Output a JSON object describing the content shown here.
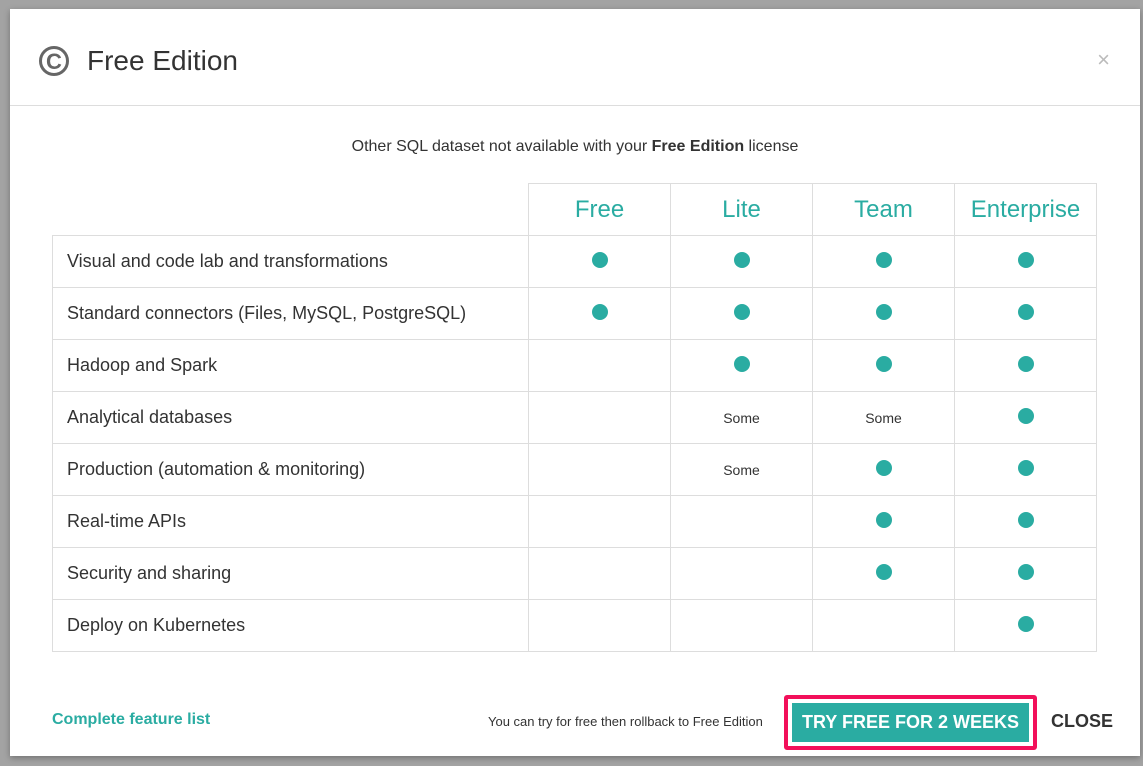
{
  "header": {
    "title": "Free Edition",
    "logo_icon": "copyright-icon",
    "close_icon": "×"
  },
  "subtitle": {
    "prefix": "Other SQL dataset not available with your ",
    "bold": "Free Edition",
    "suffix": " license"
  },
  "table": {
    "columns": [
      "Free",
      "Lite",
      "Team",
      "Enterprise"
    ],
    "rows": [
      {
        "feature": "Visual and code lab and transformations",
        "values": [
          "dot",
          "dot",
          "dot",
          "dot"
        ]
      },
      {
        "feature": "Standard connectors (Files, MySQL, PostgreSQL)",
        "values": [
          "dot",
          "dot",
          "dot",
          "dot"
        ]
      },
      {
        "feature": "Hadoop and Spark",
        "values": [
          "",
          "dot",
          "dot",
          "dot"
        ]
      },
      {
        "feature": "Analytical databases",
        "values": [
          "",
          "Some",
          "Some",
          "dot"
        ]
      },
      {
        "feature": "Production (automation & monitoring)",
        "values": [
          "",
          "Some",
          "dot",
          "dot"
        ]
      },
      {
        "feature": "Real-time APIs",
        "values": [
          "",
          "",
          "dot",
          "dot"
        ]
      },
      {
        "feature": "Security and sharing",
        "values": [
          "",
          "",
          "dot",
          "dot"
        ]
      },
      {
        "feature": "Deploy on Kubernetes",
        "values": [
          "",
          "",
          "",
          "dot"
        ]
      }
    ]
  },
  "footer": {
    "feature_list_link": "Complete feature list",
    "note": "You can try for free then rollback to Free Edition",
    "try_button": "TRY FREE FOR 2 WEEKS",
    "close_button": "CLOSE"
  },
  "colors": {
    "accent": "#2aaca2",
    "highlight": "#f2105a"
  }
}
